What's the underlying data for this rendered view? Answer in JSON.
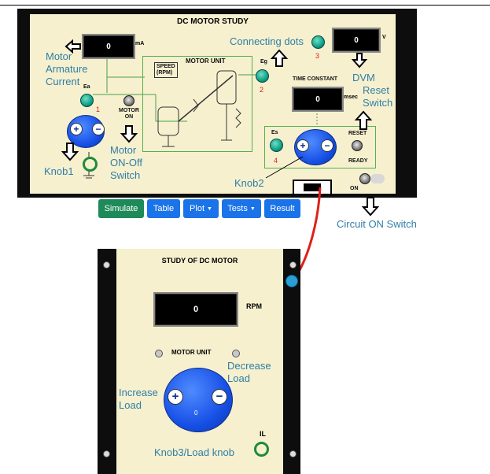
{
  "panel1": {
    "title": "DC MOTOR STUDY",
    "ma_meter_value": "0",
    "ma_unit": "mA",
    "v_meter_value": "0",
    "v_unit": "V",
    "time_constant_label": "TIME CONSTANT",
    "time_constant_value": "0",
    "time_constant_unit": "msec",
    "motor_unit_label": "MOTOR UNIT",
    "speed_label": "SPEED\n(RPM)",
    "ea_label": "Ea",
    "eg_label": "Eg",
    "es_label": "Es",
    "motor_on_label": "MOTOR\nON",
    "reset_label": "RESET",
    "ready_label": "READY",
    "on_label": "ON",
    "dot_numbers": [
      "1",
      "2",
      "3",
      "4"
    ]
  },
  "annotations": {
    "motor_armature_current": "Motor\nArmature\nCurrent",
    "connecting_dots": "Connecting dots",
    "dvm": "DVM",
    "reset_switch": "Reset\nSwitch",
    "motor_on_off_switch": "Motor\nON-Off\nSwitch",
    "knob1": "Knob1",
    "knob2": "Knob2",
    "circuit_on_switch": "Circuit ON Switch",
    "increase_load": "Increase\nLoad",
    "decrease_load": "Decrease\nLoad",
    "knob3": "Knob3/Load knob"
  },
  "toolbar": {
    "simulate": "Simulate",
    "table": "Table",
    "plot": "Plot",
    "tests": "Tests",
    "result": "Result"
  },
  "panel2": {
    "title": "STUDY OF DC MOTOR",
    "rpm_value": "0",
    "rpm_unit": "RPM",
    "motor_unit_label": "MOTOR UNIT",
    "knob3_value": "0",
    "il_label": "IL"
  },
  "colors": {
    "annotation_text": "#2f7ea6",
    "panel_bg": "#f6f0cf",
    "knob_blue": "#1750e6",
    "dot_teal": "#0f9f8a",
    "button_green": "#1e8a5a",
    "button_blue": "#1a73e8",
    "wire_red": "#e0201a"
  }
}
